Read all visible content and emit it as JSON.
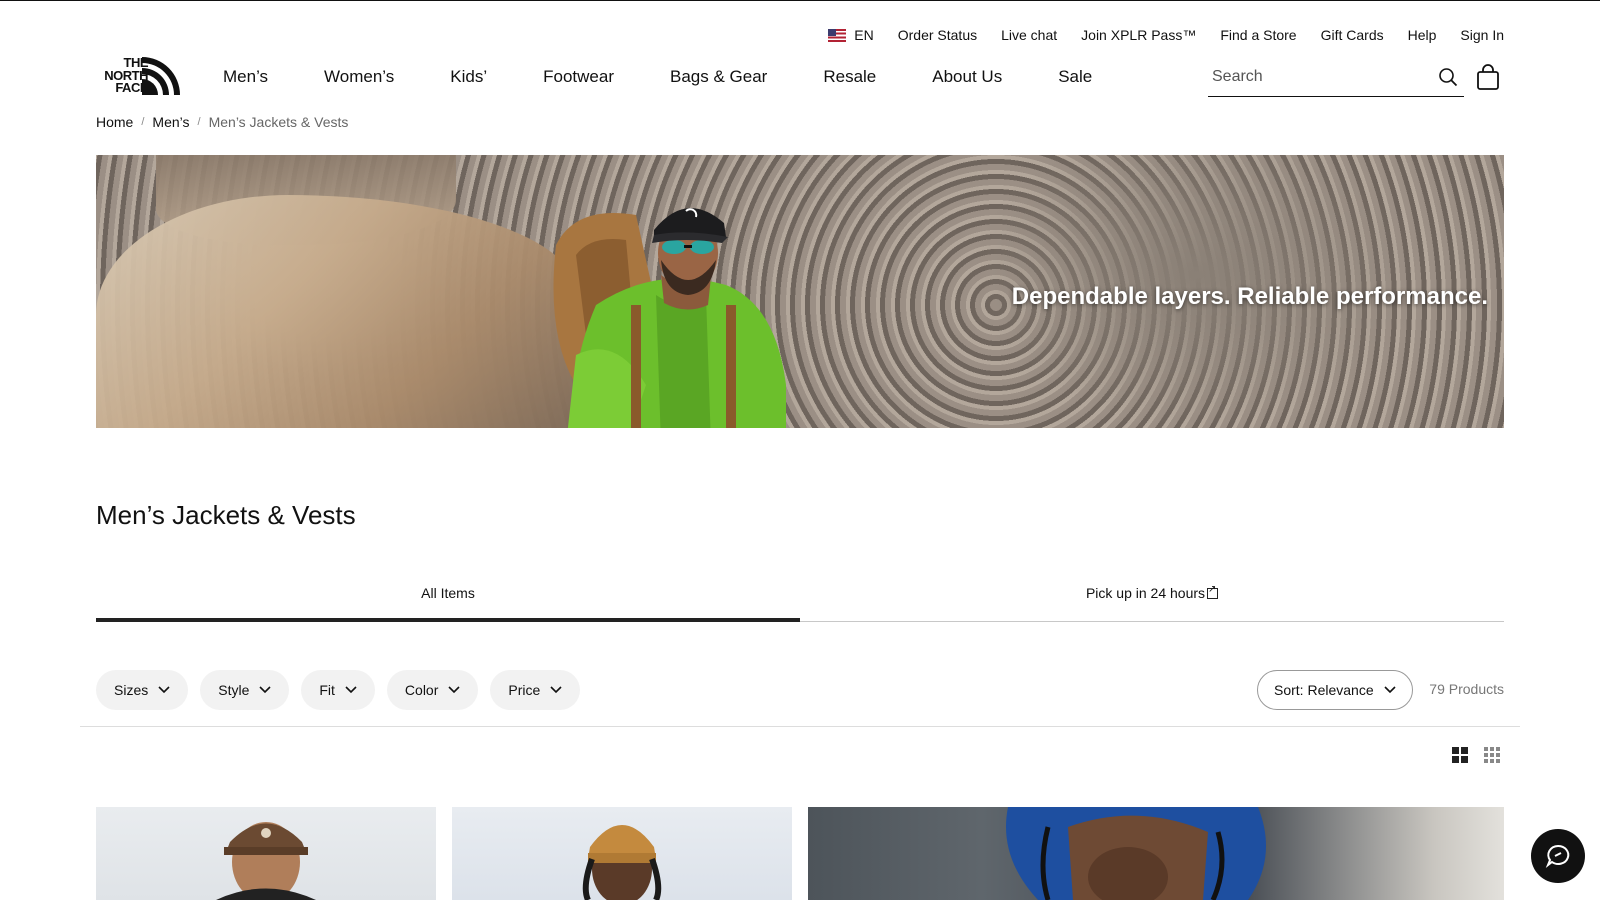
{
  "utility": {
    "language": "EN",
    "links": [
      "Order Status",
      "Live chat",
      "Join XPLR Pass™",
      "Find a Store",
      "Gift Cards",
      "Help",
      "Sign In"
    ]
  },
  "brand": {
    "logo_lines": [
      "THE",
      "NORTH",
      "FACE"
    ]
  },
  "nav": {
    "items": [
      "Men’s",
      "Women’s",
      "Kids’",
      "Footwear",
      "Bags & Gear",
      "Resale",
      "About Us",
      "Sale"
    ]
  },
  "search": {
    "placeholder": "Search",
    "value": ""
  },
  "breadcrumb": {
    "items": [
      "Home",
      "Men’s"
    ],
    "current": "Men’s Jackets & Vests",
    "separator": "/"
  },
  "hero": {
    "tagline": "Dependable layers. Reliable performance."
  },
  "page": {
    "title": "Men’s Jackets & Vests"
  },
  "tabs": [
    {
      "label": "All Items",
      "active": true
    },
    {
      "label": "Pick up in 24 hours",
      "active": false
    }
  ],
  "filters": [
    "Sizes",
    "Style",
    "Fit",
    "Color",
    "Price"
  ],
  "sort": {
    "label": "Sort: Relevance"
  },
  "results": {
    "count": "79 Products"
  },
  "icons": {
    "search": "search-icon",
    "bag": "shopping-bag-icon",
    "flag": "us-flag-icon",
    "chevron": "chevron-down-icon",
    "chat": "chat-icon",
    "grid_large": "grid-large-icon",
    "grid_small": "grid-small-icon",
    "external": "external-link-icon"
  },
  "colors": {
    "text": "#111111",
    "chip_bg": "#f2f2f2",
    "accent": "#222222"
  }
}
